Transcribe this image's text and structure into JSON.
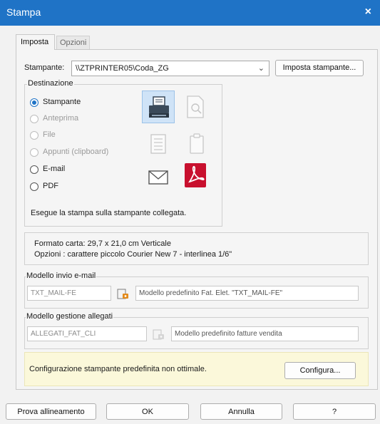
{
  "window": {
    "title": "Stampa",
    "close_glyph": "×"
  },
  "tabs": [
    {
      "label": "Imposta",
      "active": true
    },
    {
      "label": "Opzioni",
      "active": false
    }
  ],
  "printer": {
    "label": "Stampante:",
    "value": "\\\\ZTPRINTER05\\Coda_ZG",
    "setup_button": "Imposta stampante..."
  },
  "destination": {
    "caption": "Destinazione",
    "options": [
      {
        "label": "Stampante",
        "checked": true,
        "enabled": true
      },
      {
        "label": "Anteprima",
        "checked": false,
        "enabled": false
      },
      {
        "label": "File",
        "checked": false,
        "enabled": false
      },
      {
        "label": "Appunti (clipboard)",
        "checked": false,
        "enabled": false
      },
      {
        "label": "E-mail",
        "checked": false,
        "enabled": true
      },
      {
        "label": "PDF",
        "checked": false,
        "enabled": true
      }
    ],
    "icons": [
      "printer-icon",
      "preview-icon",
      "file-icon",
      "clipboard-icon",
      "email-icon",
      "pdf-icon"
    ],
    "description": "Esegue la stampa sulla stampante collegata."
  },
  "info": {
    "paper_format": "Formato carta: 29,7 x 21,0 cm Verticale",
    "options": "Opzioni : carattere piccolo Courier New 7 - interlinea 1/6\""
  },
  "email_template": {
    "caption": "Modello invio e-mail",
    "code": "TXT_MAIL-FE",
    "description": "Modello predefinito Fat. Elet. \"TXT_MAIL-FE\""
  },
  "attachments_template": {
    "caption": "Modello gestione allegati",
    "code": "ALLEGATI_FAT_CLI",
    "description": "Modello predefinito fatture vendita"
  },
  "warning": {
    "text": "Configurazione stampante predefinita non ottimale.",
    "button": "Configura..."
  },
  "footer": {
    "align_button": "Prova allineamento",
    "ok_button": "OK",
    "cancel_button": "Annulla",
    "help_button": "?"
  },
  "colors": {
    "titlebar": "#1f73c6",
    "radio_accent": "#1f73c6",
    "warning_bg": "#fbf8da",
    "pdf_red": "#c8102e"
  }
}
